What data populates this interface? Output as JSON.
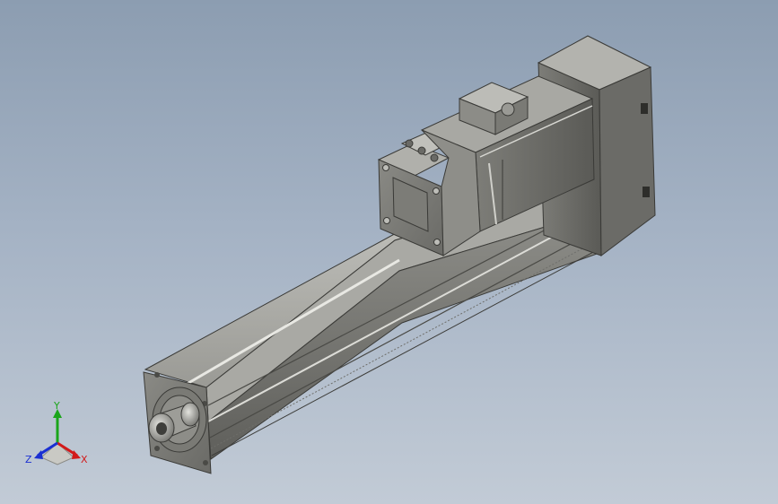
{
  "viewport": {
    "background_top": "#8c9db1",
    "background_bottom": "#c2cbd6"
  },
  "model": {
    "name": "linear-actuator-with-servo-motor",
    "body_color": "#858580",
    "highlight_color": "#d9d9d4",
    "shadow_color": "#3a3a37"
  },
  "triad": {
    "x_label": "X",
    "y_label": "Y",
    "z_label": "Z",
    "x_color": "#d21a1a",
    "y_color": "#1aa51a",
    "z_color": "#1a2fd2"
  }
}
